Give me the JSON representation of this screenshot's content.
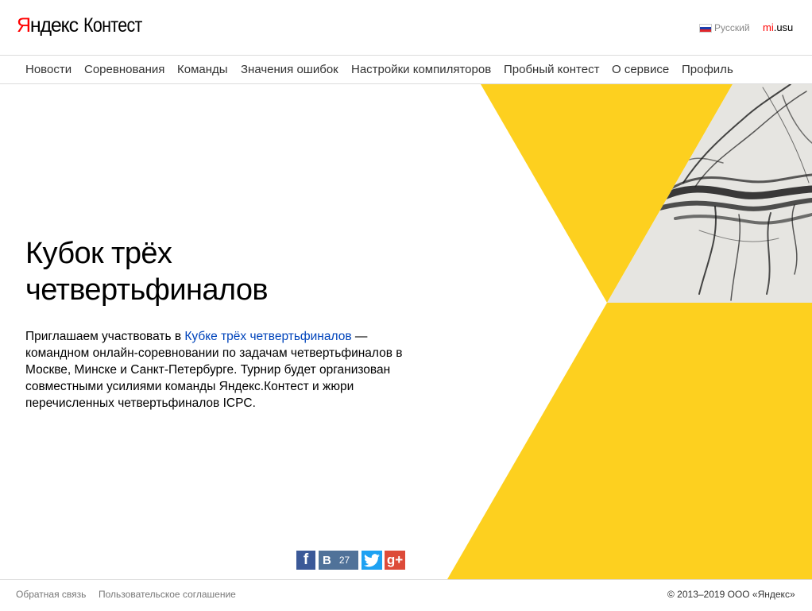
{
  "header": {
    "logo_yandex_first": "Я",
    "logo_yandex_rest": "ндекс",
    "logo_contest": "Контест",
    "language": "Русский",
    "user_first": "mi",
    "user_rest": ".usu"
  },
  "nav": {
    "items": [
      {
        "label": "Новости"
      },
      {
        "label": "Соревнования"
      },
      {
        "label": "Команды"
      },
      {
        "label": "Значения ошибок"
      },
      {
        "label": "Настройки компиляторов"
      },
      {
        "label": "Пробный контест"
      },
      {
        "label": "О сервисе"
      },
      {
        "label": "Профиль"
      }
    ]
  },
  "banner": {
    "title_line1": "Кубок трёх",
    "title_line2": "четвертьфиналов",
    "desc_before": "Приглашаем участвовать в ",
    "desc_link": "Кубке трёх четвертьфиналов",
    "desc_after": " — командном онлайн-соревновании по задачам четвертьфиналов в Москве, Минске и Санкт-Петербурге. Турнир будет организован совместными усилиями команды Яндекс.Контест и жюри перечисленных четвертьфиналов ICPC."
  },
  "social": {
    "facebook": "f",
    "vk": "В",
    "vk_count": "27",
    "gplus": "g+"
  },
  "footer": {
    "feedback": "Обратная связь",
    "agreement": "Пользовательское соглашение",
    "copyright": "© 2013–2019  ООО «Яндекс»"
  },
  "colors": {
    "accent_yellow": "#fdd01f",
    "link_blue": "#0044bb",
    "brand_red": "#ff0000"
  }
}
